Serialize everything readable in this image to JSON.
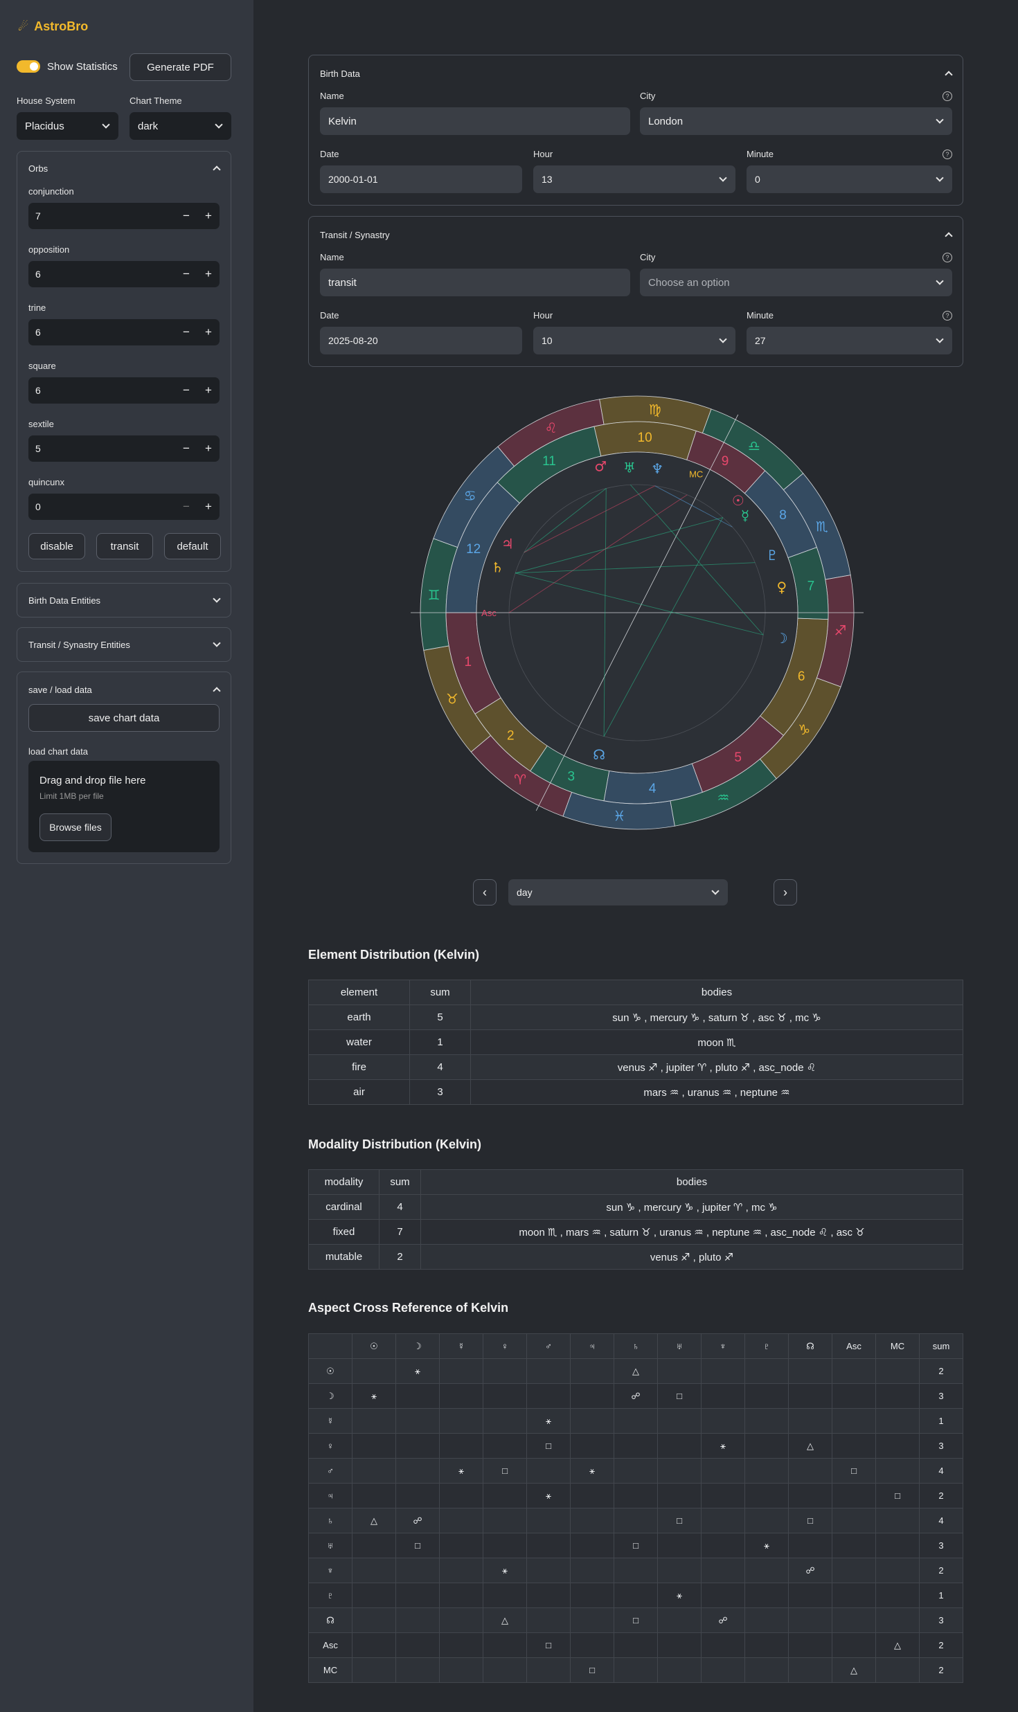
{
  "app": {
    "title": "AstroBro"
  },
  "sidebar": {
    "show_statistics": "Show Statistics",
    "generate_pdf": "Generate PDF",
    "house_system_label": "House System",
    "house_system_value": "Placidus",
    "chart_theme_label": "Chart Theme",
    "chart_theme_value": "dark",
    "orbs_title": "Orbs",
    "orbs": [
      {
        "label": "conjunction",
        "value": "7"
      },
      {
        "label": "opposition",
        "value": "6"
      },
      {
        "label": "trine",
        "value": "6"
      },
      {
        "label": "square",
        "value": "6"
      },
      {
        "label": "sextile",
        "value": "5"
      },
      {
        "label": "quincunx",
        "value": "0"
      }
    ],
    "orb_buttons": {
      "disable": "disable",
      "transit": "transit",
      "default": "default"
    },
    "birth_entities": "Birth Data Entities",
    "transit_entities": "Transit / Synastry Entities",
    "save_load_title": "save / load data",
    "save_button": "save chart data",
    "load_label": "load chart data",
    "drop_text": "Drag and drop file here",
    "drop_limit": "Limit 1MB per file",
    "browse": "Browse files"
  },
  "birth": {
    "title": "Birth Data",
    "name_label": "Name",
    "name_value": "Kelvin",
    "city_label": "City",
    "city_value": "London",
    "date_label": "Date",
    "date_value": "2000-01-01",
    "hour_label": "Hour",
    "hour_value": "13",
    "minute_label": "Minute",
    "minute_value": "0"
  },
  "transit": {
    "title": "Transit / Synastry",
    "name_label": "Name",
    "name_value": "transit",
    "city_label": "City",
    "city_placeholder": "Choose an option",
    "date_label": "Date",
    "date_value": "2025-08-20",
    "hour_label": "Hour",
    "hour_value": "10",
    "minute_label": "Minute",
    "minute_value": "27"
  },
  "chart": {
    "signs": [
      "♈",
      "♉",
      "♊",
      "♋",
      "♌",
      "♍",
      "♎",
      "♏",
      "♐",
      "♑",
      "♒",
      "♓"
    ],
    "houses": [
      "1",
      "2",
      "3",
      "4",
      "5",
      "6",
      "7",
      "8",
      "9",
      "10",
      "11",
      "12"
    ],
    "mc": "MC",
    "asc": "Asc",
    "colors": {
      "fire": "#e8486c",
      "earth": "#f2b92c",
      "air": "#29c48f",
      "water": "#5ba6e6"
    },
    "planets": [
      {
        "glyph": "♂",
        "color": "#e8486c"
      },
      {
        "glyph": "♅",
        "color": "#29c48f"
      },
      {
        "glyph": "♆",
        "color": "#5ba6e6"
      },
      {
        "glyph": "☉",
        "color": "#e8486c"
      },
      {
        "glyph": "☿",
        "color": "#29c48f"
      },
      {
        "glyph": "♇",
        "color": "#5ba6e6"
      },
      {
        "glyph": "♀",
        "color": "#f2b92c"
      },
      {
        "glyph": "☽",
        "color": "#5ba6e6"
      },
      {
        "glyph": "♃",
        "color": "#e8486c"
      },
      {
        "glyph": "♄",
        "color": "#f2b92c"
      },
      {
        "glyph": "☊",
        "color": "#5ba6e6"
      }
    ]
  },
  "nav": {
    "period": "day"
  },
  "element_dist": {
    "title": "Element Distribution (Kelvin)",
    "headers": [
      "element",
      "sum",
      "bodies"
    ],
    "rows": [
      [
        "earth",
        "5",
        "sun ♑ , mercury ♑ , saturn ♉ , asc ♉ , mc ♑"
      ],
      [
        "water",
        "1",
        "moon ♏"
      ],
      [
        "fire",
        "4",
        "venus ♐ , jupiter ♈ , pluto ♐ , asc_node ♌"
      ],
      [
        "air",
        "3",
        "mars ♒ , uranus ♒ , neptune ♒"
      ]
    ]
  },
  "modality_dist": {
    "title": "Modality Distribution (Kelvin)",
    "headers": [
      "modality",
      "sum",
      "bodies"
    ],
    "rows": [
      [
        "cardinal",
        "4",
        "sun ♑ , mercury ♑ , jupiter ♈ , mc ♑"
      ],
      [
        "fixed",
        "7",
        "moon ♏ , mars ♒ , saturn ♉ , uranus ♒ , neptune ♒ , asc_node ♌ , asc ♉"
      ],
      [
        "mutable",
        "2",
        "venus ♐ , pluto ♐"
      ]
    ]
  },
  "aspects": {
    "title": "Aspect Cross Reference of Kelvin",
    "headers": [
      "",
      "☉",
      "☽",
      "☿",
      "♀",
      "♂",
      "♃",
      "♄",
      "♅",
      "♆",
      "♇",
      "☊",
      "Asc",
      "MC",
      "sum"
    ],
    "rows": [
      [
        "☉",
        "",
        "⚹",
        "",
        "",
        "",
        "",
        "△",
        "",
        "",
        "",
        "",
        "",
        "",
        "2"
      ],
      [
        "☽",
        "⚹",
        "",
        "",
        "",
        "",
        "",
        "☍",
        "□",
        "",
        "",
        "",
        "",
        "",
        "3"
      ],
      [
        "☿",
        "",
        "",
        "",
        "",
        "⚹",
        "",
        "",
        "",
        "",
        "",
        "",
        "",
        "",
        "1"
      ],
      [
        "♀",
        "",
        "",
        "",
        "",
        "□",
        "",
        "",
        "",
        "⚹",
        "",
        "△",
        "",
        "",
        "3"
      ],
      [
        "♂",
        "",
        "",
        "⚹",
        "□",
        "",
        "⚹",
        "",
        "",
        "",
        "",
        "",
        "□",
        "",
        "4"
      ],
      [
        "♃",
        "",
        "",
        "",
        "",
        "⚹",
        "",
        "",
        "",
        "",
        "",
        "",
        "",
        "□",
        "2"
      ],
      [
        "♄",
        "△",
        "☍",
        "",
        "",
        "",
        "",
        "",
        "□",
        "",
        "",
        "□",
        "",
        "",
        "4"
      ],
      [
        "♅",
        "",
        "□",
        "",
        "",
        "",
        "",
        "□",
        "",
        "",
        "⚹",
        "",
        "",
        "",
        "3"
      ],
      [
        "♆",
        "",
        "",
        "",
        "⚹",
        "",
        "",
        "",
        "",
        "",
        "",
        "☍",
        "",
        "",
        "2"
      ],
      [
        "♇",
        "",
        "",
        "",
        "",
        "",
        "",
        "",
        "⚹",
        "",
        "",
        "",
        "",
        "",
        "1"
      ],
      [
        "☊",
        "",
        "",
        "",
        "△",
        "",
        "",
        "□",
        "",
        "☍",
        "",
        "",
        "",
        "",
        "3"
      ],
      [
        "Asc",
        "",
        "",
        "",
        "",
        "□",
        "",
        "",
        "",
        "",
        "",
        "",
        "",
        "△",
        "2"
      ],
      [
        "MC",
        "",
        "",
        "",
        "",
        "",
        "□",
        "",
        "",
        "",
        "",
        "",
        "△",
        "",
        "2"
      ]
    ]
  }
}
